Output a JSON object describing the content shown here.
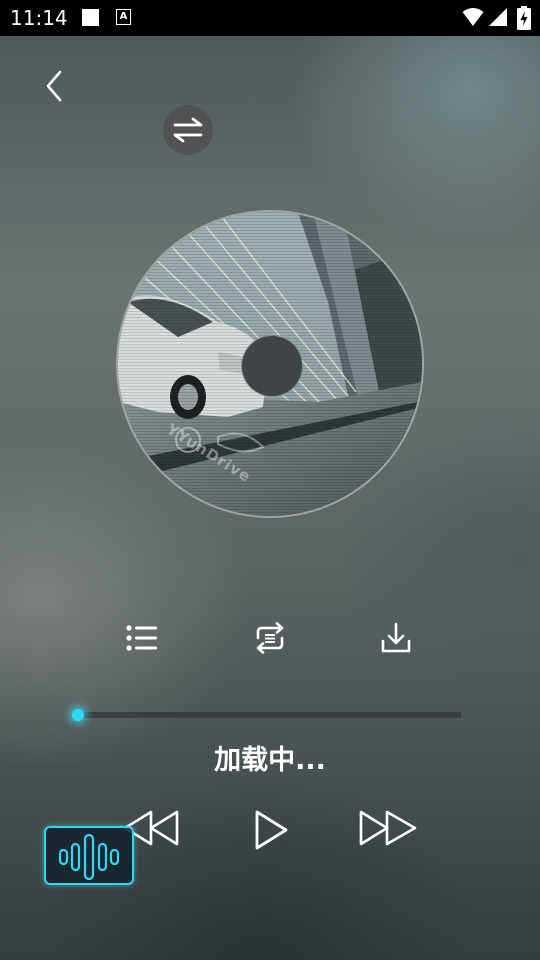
{
  "status_bar": {
    "time": "11:14",
    "icons": [
      "notification-square-icon",
      "keyboard-a-icon",
      "wifi-icon",
      "cell-signal-icon",
      "battery-charging-icon"
    ],
    "text_color": "#ffffff"
  },
  "nav": {
    "back_icon": "chevron-left-icon",
    "switch_icon": "swap-arrows-icon"
  },
  "album": {
    "watermark_text": "YYunDrive"
  },
  "actions": [
    {
      "icon": "playlist-icon"
    },
    {
      "icon": "repeat-loop-icon"
    },
    {
      "icon": "download-icon"
    }
  ],
  "player": {
    "progress": 0.0,
    "status_text": "加载中...",
    "accent_color": "#35d6f2"
  },
  "controls": {
    "previous_icon": "rewind-icon",
    "play_icon": "play-icon",
    "next_icon": "fast-forward-icon",
    "voice_icon": "voice-waveform-icon"
  }
}
